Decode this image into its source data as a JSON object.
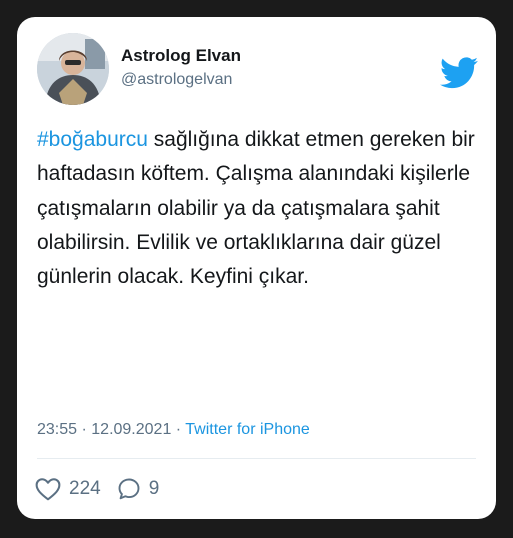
{
  "tweet": {
    "author": {
      "display_name": "Astrolog Elvan",
      "handle": "@astrologelvan",
      "avatar_icon": "avatar-photo"
    },
    "brand": {
      "logo_icon": "twitter-bird-icon",
      "logo_color": "#1DA1F2"
    },
    "text": {
      "hashtag": "#boğaburcu",
      "body": " sağlığına dikkat etmen gereken bir haftadasın köftem. Çalışma alanındaki kişilerle çatışmaların olabilir ya da çatışmalara şahit olabilirsin. Evlilik ve ortaklıklarına dair güzel günlerin olacak. Keyfini çıkar."
    },
    "meta": {
      "time": "23:55",
      "separator_1": " · ",
      "date": "12.09.2021",
      "separator_2": " · ",
      "source": "Twitter for iPhone"
    },
    "actions": {
      "like_icon": "heart-icon",
      "like_count": "224",
      "reply_icon": "speech-bubble-icon",
      "reply_count": "9"
    }
  }
}
